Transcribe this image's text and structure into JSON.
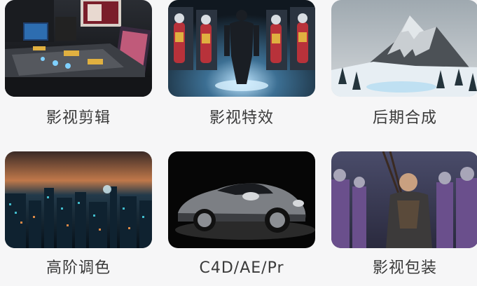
{
  "services": [
    {
      "label": "影视剪辑",
      "image": "editing-suite-image"
    },
    {
      "label": "影视特效",
      "image": "ironman-suits-image"
    },
    {
      "label": "后期合成",
      "image": "snowy-mountain-image"
    },
    {
      "label": "高阶调色",
      "image": "city-night-image"
    },
    {
      "label": "C4D/AE/Pr",
      "image": "sports-car-image"
    },
    {
      "label": "影视包装",
      "image": "warrior-scene-image"
    }
  ]
}
